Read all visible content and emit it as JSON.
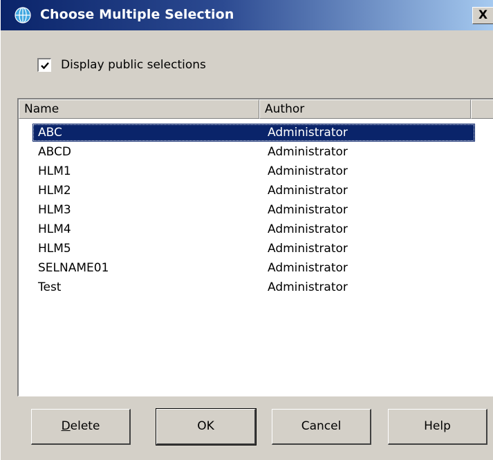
{
  "window": {
    "title": "Choose Multiple Selection",
    "close_label": "X"
  },
  "options": {
    "display_public_label": "Display public selections",
    "display_public_checked": true
  },
  "list": {
    "columns": [
      "Name",
      "Author",
      ""
    ],
    "rows": [
      {
        "name": "ABC",
        "author": "Administrator",
        "selected": true
      },
      {
        "name": "ABCD",
        "author": "Administrator"
      },
      {
        "name": "HLM1",
        "author": "Administrator"
      },
      {
        "name": "HLM2",
        "author": "Administrator"
      },
      {
        "name": "HLM3",
        "author": "Administrator"
      },
      {
        "name": "HLM4",
        "author": "Administrator"
      },
      {
        "name": "HLM5",
        "author": "Administrator"
      },
      {
        "name": "SELNAME01",
        "author": "Administrator"
      },
      {
        "name": "Test",
        "author": "Administrator"
      }
    ]
  },
  "buttons": {
    "delete_accel": "D",
    "delete_rest": "elete",
    "ok": "OK",
    "cancel": "Cancel",
    "help": "Help"
  },
  "colors": {
    "selection": "#0a246a",
    "face": "#d4d0c8"
  }
}
